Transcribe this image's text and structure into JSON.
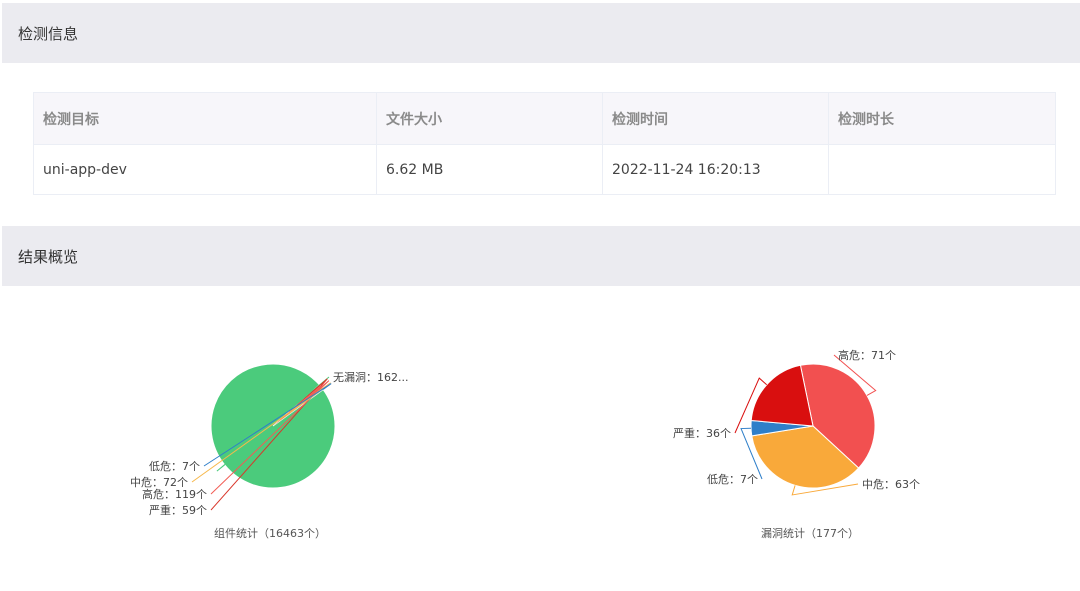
{
  "sections": {
    "info_title": "检测信息",
    "overview_title": "结果概览"
  },
  "table": {
    "headers": [
      "检测目标",
      "文件大小",
      "检测时间",
      "检测时长"
    ],
    "row": [
      "uni-app-dev",
      "6.62 MB",
      "2022-11-24 16:20:13",
      ""
    ]
  },
  "chart_data": [
    {
      "type": "pie",
      "caption": "组件统计（16463个）",
      "slices": [
        {
          "label": "无漏洞：162...",
          "name": "无漏洞",
          "value": 16206,
          "color": "#4bcb7c"
        },
        {
          "label": "严重：59个",
          "name": "严重",
          "value": 59,
          "color": "#d9372b"
        },
        {
          "label": "高危：119个",
          "name": "高危",
          "value": 119,
          "color": "#f25c54"
        },
        {
          "label": "中危：72个",
          "name": "中危",
          "value": 72,
          "color": "#f6b84c"
        },
        {
          "label": "低危：7个",
          "name": "低危",
          "value": 7,
          "color": "#2f7fc9"
        }
      ]
    },
    {
      "type": "pie",
      "caption": "漏洞统计（177个）",
      "slices": [
        {
          "label": "高危：71个",
          "name": "高危",
          "value": 71,
          "color": "#f25050"
        },
        {
          "label": "中危：63个",
          "name": "中危",
          "value": 63,
          "color": "#f9a93a"
        },
        {
          "label": "低危：7个",
          "name": "低危",
          "value": 7,
          "color": "#2f7fc9"
        },
        {
          "label": "严重：36个",
          "name": "严重",
          "value": 36,
          "color": "#d90f0f"
        }
      ]
    }
  ]
}
